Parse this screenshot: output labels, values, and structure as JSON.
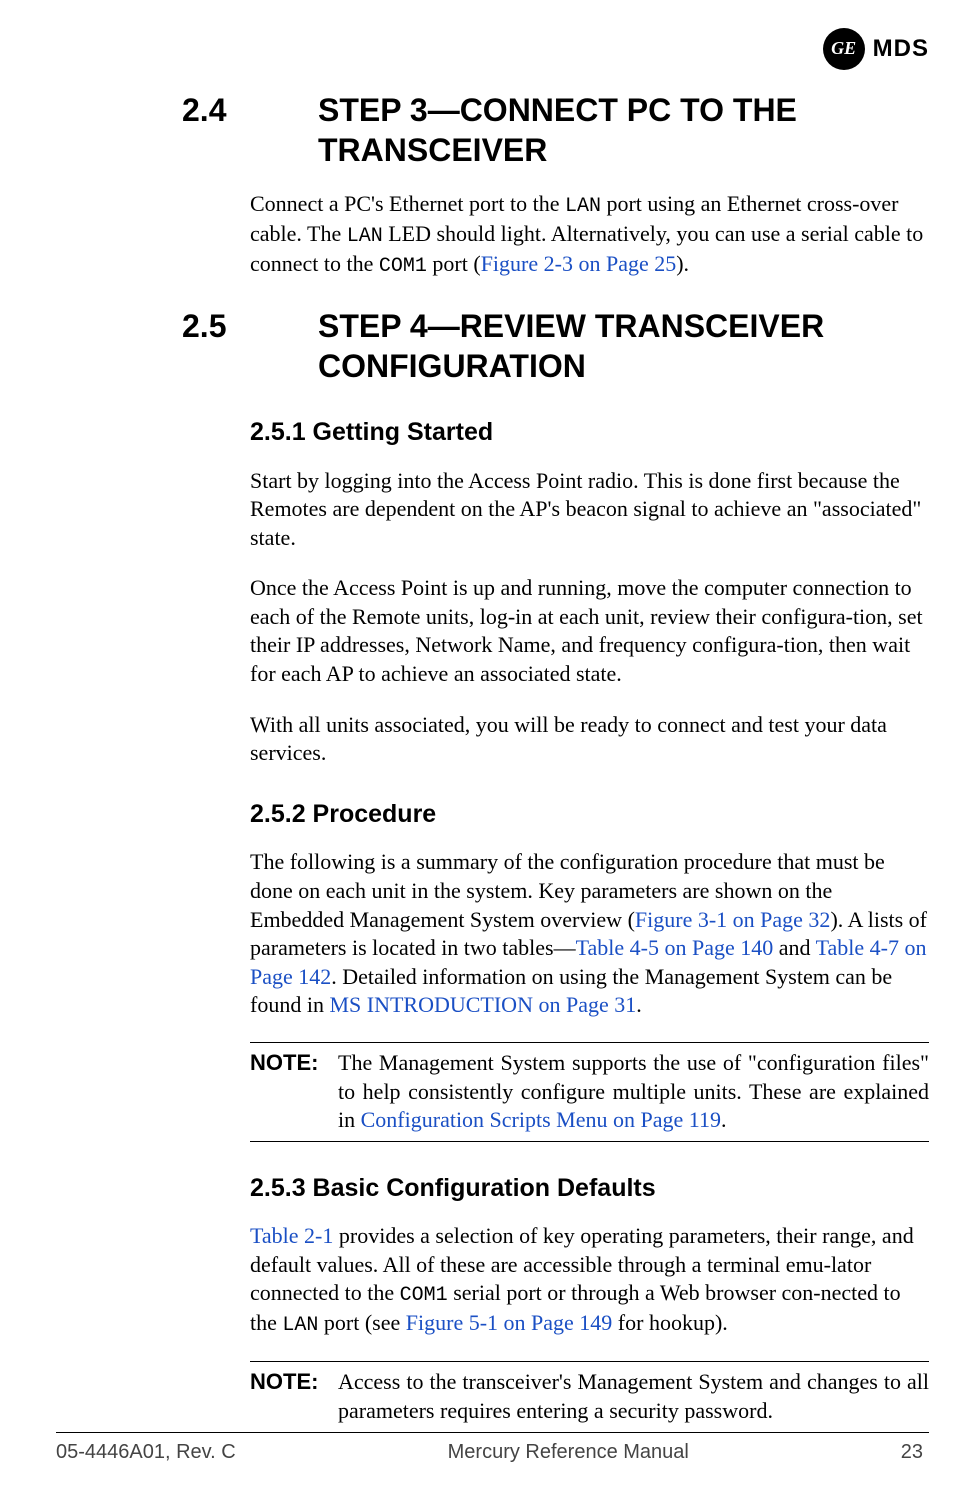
{
  "logo": {
    "ge": "GE",
    "mds": "MDS"
  },
  "sections": {
    "s24": {
      "num": "2.4",
      "title": "STEP 3—CONNECT PC TO THE TRANSCEIVER",
      "p1a": "Connect a PC's Ethernet port to the ",
      "p1b": "LAN",
      "p1c": " port using an Ethernet cross-over cable. The ",
      "p1d": "LAN",
      "p1e": " LED should light. Alternatively, you can use a serial cable to connect to the ",
      "p1f": "COM1",
      "p1g": " port (",
      "link1": "Figure 2-3 on Page 25",
      "p1h": ")."
    },
    "s25": {
      "num": "2.5",
      "title": "STEP 4—REVIEW TRANSCEIVER CONFIGURATION"
    },
    "s251": {
      "heading": "2.5.1 Getting Started",
      "p1": "Start by logging into the Access Point radio. This is done first because the Remotes are dependent on the AP's beacon signal to achieve an \"associated\" state.",
      "p2": "Once the Access Point is up and running, move the computer connection to each of the Remote units, log-in at each unit, review their configura-tion, set their IP addresses, Network Name, and frequency configura-tion, then wait for each AP to achieve an associated state.",
      "p3": "With all units associated, you will be ready to connect and test your data services."
    },
    "s252": {
      "heading": "2.5.2 Procedure",
      "p1a": "The following is a summary of the configuration procedure that must be done on each unit in the system. Key parameters are shown on the Embedded Management System overview (",
      "link2": "Figure 3-1 on Page 32",
      "p1b": "). A lists of parameters is located in two tables—",
      "link3": "Table 4-5 on Page 140",
      "p1c": " and ",
      "link4": "Table 4-7 on Page 142",
      "p1d": ". Detailed information on using the Management System can be found in ",
      "link5": "MS INTRODUCTION on Page 31",
      "p1e": ".",
      "note_label": "NOTE:",
      "note_a": "The Management System supports the use of \"configuration files\" to help consistently configure multiple units. These are explained in ",
      "note_link": "Configuration Scripts Menu on Page 119",
      "note_b": "."
    },
    "s253": {
      "heading": "2.5.3 Basic Configuration Defaults",
      "link6": "Table 2-1",
      "p1a": " provides a selection of key operating parameters, their range, and default values. All of these are accessible through a terminal emu-lator connected to the ",
      "p1b": "COM1",
      "p1c": " serial port or through a Web browser con-nected to the ",
      "p1d": "LAN",
      "p1e": " port (see ",
      "link7": "Figure 5-1 on Page 149",
      "p1f": " for hookup).",
      "note_label": "NOTE:",
      "note_text": "Access to the transceiver's Management System and changes to all parameters requires entering a security password."
    }
  },
  "footer": {
    "left": "05-4446A01, Rev. C",
    "center": "Mercury Reference Manual",
    "right": "23"
  }
}
